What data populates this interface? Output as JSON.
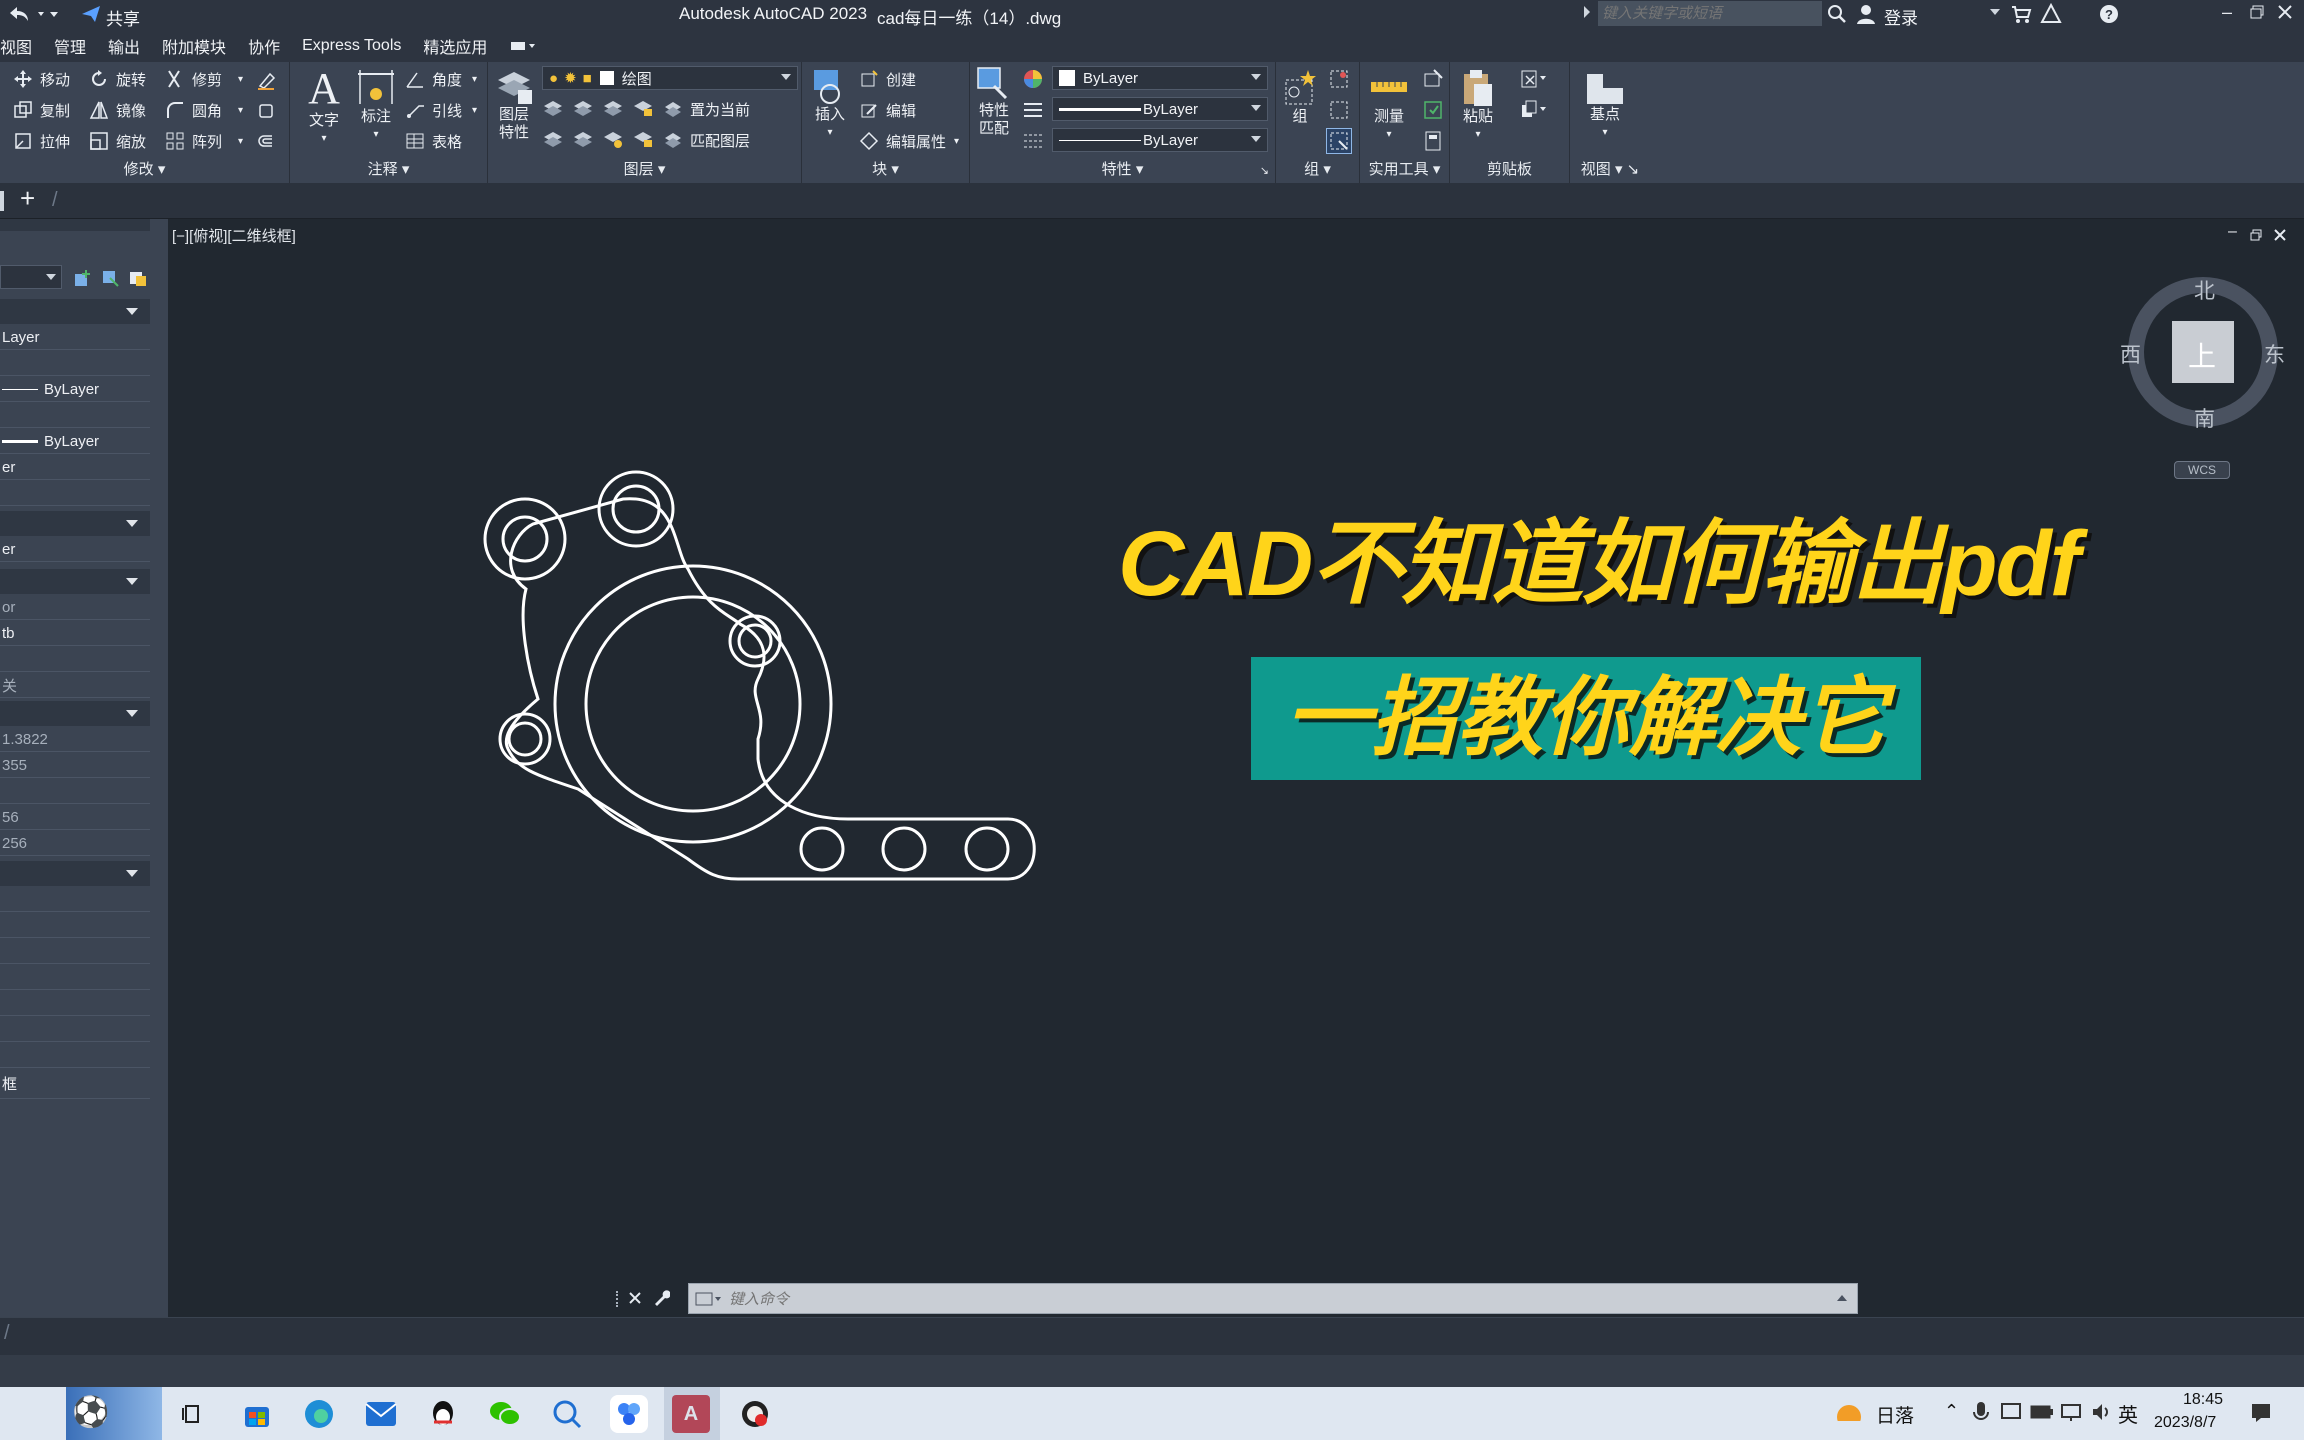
{
  "app": {
    "title": "Autodesk AutoCAD 2023",
    "file": "cad每日一练（14）.dwg",
    "share_label": "共享",
    "search_placeholder": "键入关键字或短语",
    "login_label": "登录"
  },
  "menu": [
    "视图",
    "管理",
    "输出",
    "附加模块",
    "协作",
    "Express Tools",
    "精选应用"
  ],
  "ribbon": {
    "modify": {
      "label": "修改",
      "tools": [
        "移动",
        "旋转",
        "修剪",
        "复制",
        "镜像",
        "圆角",
        "拉伸",
        "缩放",
        "阵列"
      ]
    },
    "annotation": {
      "label": "注释",
      "text": "文字",
      "dim": "标注",
      "tools": [
        "角度",
        "引线",
        "表格"
      ]
    },
    "layers": {
      "label": "图层",
      "props": "图层\n特性",
      "current_layer": "绘图",
      "tools": [
        "置为当前",
        "匹配图层"
      ]
    },
    "block": {
      "label": "块",
      "insert": "插入",
      "tools": [
        "创建",
        "编辑",
        "编辑属性"
      ]
    },
    "properties": {
      "label": "特性",
      "match": "特性\n匹配",
      "color": "ByLayer",
      "linetype": "ByLayer",
      "lineweight": "ByLayer"
    },
    "group": {
      "label": "组",
      "group": "组"
    },
    "utilities": {
      "label": "实用工具",
      "measure": "测量"
    },
    "clipboard": {
      "label": "剪贴板",
      "paste": "粘贴"
    },
    "view": {
      "label": "视图",
      "base": "基点"
    }
  },
  "viewport": {
    "label": "[−][俯视][二维线框]",
    "compass": {
      "north": "北",
      "south": "南",
      "east": "东",
      "west": "西",
      "top": "上",
      "wcs": "WCS"
    }
  },
  "left_panel": {
    "rows": [
      "Layer",
      "ByLayer",
      "ByLayer",
      "er",
      "er",
      "or",
      "tb",
      "关",
      "1.3822",
      "355",
      "56",
      "256",
      "框"
    ]
  },
  "overlay": {
    "headline": "CAD不知道如何输出pdf",
    "subheadline": "一招教你解决它",
    "headline_color": "#ffd41a",
    "sub_bg": "#0f9a8e"
  },
  "command": {
    "placeholder": "键入命令"
  },
  "taskbar": {
    "weather": "日落",
    "ime": "英",
    "time": "18:45",
    "date": "2023/8/7"
  },
  "colors": {
    "ribbon": "#3b4453",
    "canvas": "#212830",
    "title": "#2d3440"
  }
}
